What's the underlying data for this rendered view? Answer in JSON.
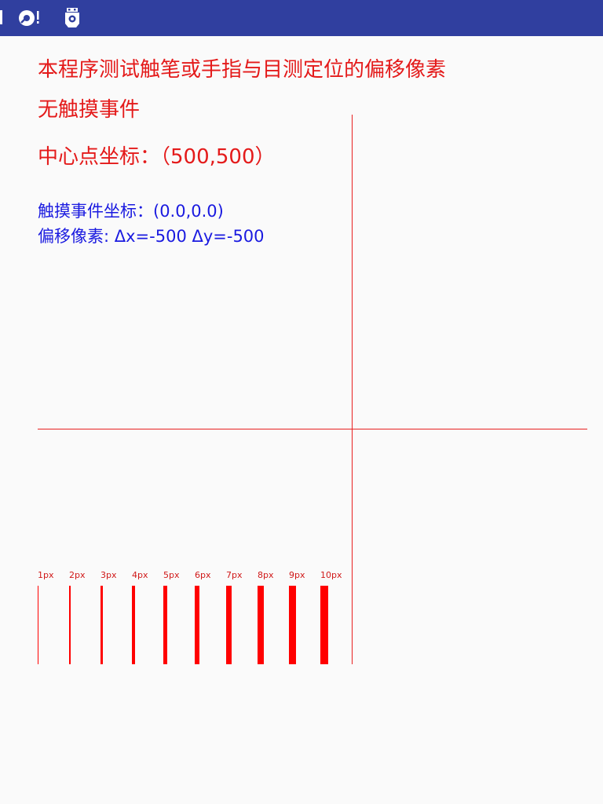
{
  "status_bar": {
    "icons": [
      "notification-icon",
      "sync-alert-icon",
      "usb-debug-icon"
    ],
    "background": "#303f9f"
  },
  "main": {
    "description": "本程序测试触笔或手指与目测定位的偏移像素",
    "touch_status": "无触摸事件",
    "center_coord": "中心点坐标：（500,500）",
    "touch_coord": "触摸事件坐标：(0.0,0.0)",
    "offset": "偏移像素: Δx=-500 Δy=-500"
  },
  "width_samples": {
    "labels": [
      "1px",
      "2px",
      "3px",
      "4px",
      "5px",
      "6px",
      "7px",
      "8px",
      "9px",
      "10px"
    ],
    "widths": [
      1,
      2,
      3,
      4,
      5,
      6,
      7,
      8,
      9,
      10
    ]
  },
  "colors": {
    "accent_red": "#e41a1a",
    "info_blue": "#1a1ae0",
    "background": "#fafafa"
  }
}
